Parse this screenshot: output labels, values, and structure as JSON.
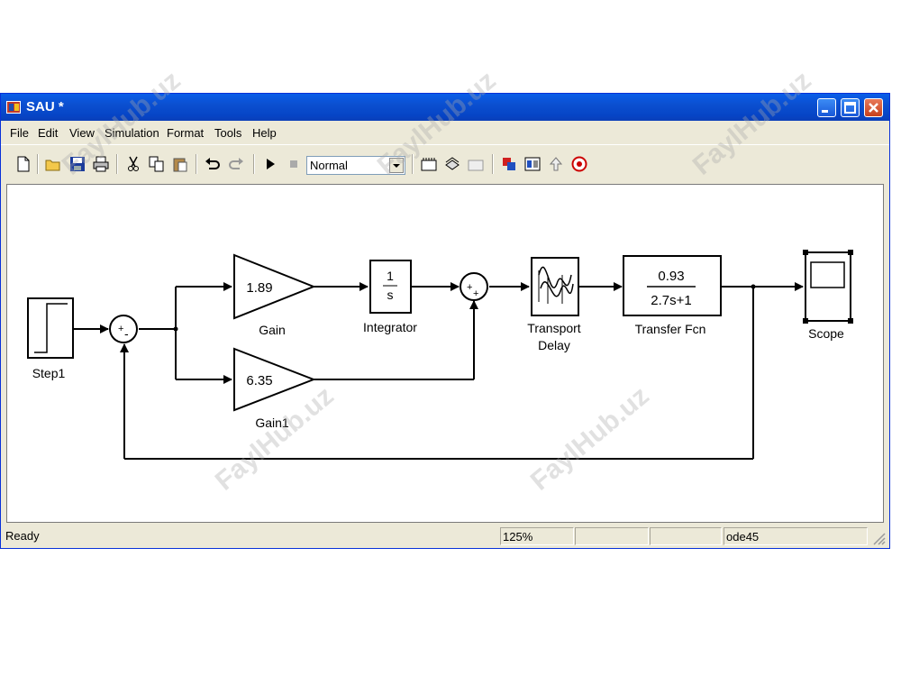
{
  "window": {
    "title": "SAU *"
  },
  "menu": [
    "File",
    "Edit",
    "View",
    "Simulation",
    "Format",
    "Tools",
    "Help"
  ],
  "toolbar": {
    "sim_mode": "Normal"
  },
  "blocks": {
    "step": "Step1",
    "gain_value": "1.89",
    "gain_label": "Gain",
    "gain1_value": "6.35",
    "gain1_label": "Gain1",
    "integrator_num": "1",
    "integrator_den": "s",
    "integrator_label": "Integrator",
    "sum1_sign_a": "+",
    "sum1_sign_b": "-",
    "sum2_sign_a": "+",
    "sum2_sign_b": "+",
    "delay_label_1": "Transport",
    "delay_label_2": "Delay",
    "tf_num": "0.93",
    "tf_den": "2.7s+1",
    "tf_label": "Transfer Fcn",
    "scope_label": "Scope"
  },
  "status": {
    "state": "Ready",
    "zoom": "125%",
    "solver": "ode45"
  },
  "watermark": "FaylHub.uz"
}
